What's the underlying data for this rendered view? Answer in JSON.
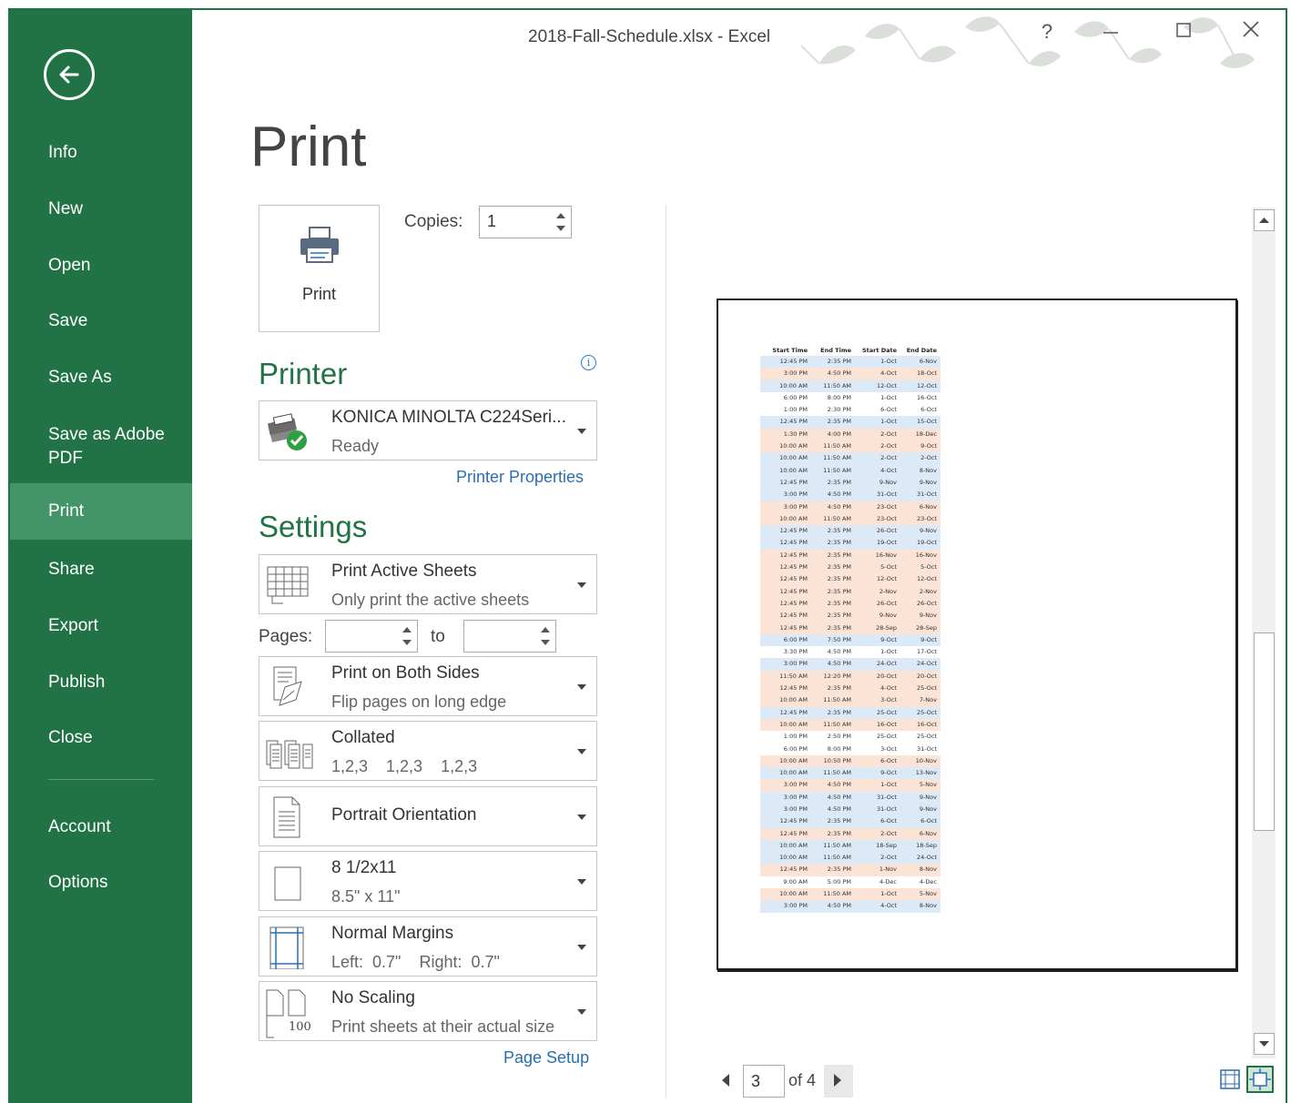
{
  "window": {
    "title": "2018-Fall-Schedule.xlsx - Excel"
  },
  "sidebar": {
    "items": [
      {
        "label": "Info"
      },
      {
        "label": "New"
      },
      {
        "label": "Open"
      },
      {
        "label": "Save"
      },
      {
        "label": "Save As"
      },
      {
        "label": "Save as Adobe\nPDF"
      },
      {
        "label": "Print"
      },
      {
        "label": "Share"
      },
      {
        "label": "Export"
      },
      {
        "label": "Publish"
      },
      {
        "label": "Close"
      },
      {
        "label": "Account"
      },
      {
        "label": "Options"
      }
    ]
  },
  "main": {
    "title": "Print",
    "print_button": "Print",
    "copies_label": "Copies:",
    "copies_value": "1",
    "printer_heading": "Printer",
    "printer": {
      "name": "KONICA MINOLTA C224Seri...",
      "status": "Ready"
    },
    "printer_properties": "Printer Properties",
    "settings_heading": "Settings",
    "settings": {
      "sheets": {
        "title": "Print Active Sheets",
        "sub": "Only print the active sheets"
      },
      "pages_label": "Pages:",
      "to_label": "to",
      "sides": {
        "title": "Print on Both Sides",
        "sub": "Flip pages on long edge"
      },
      "collated": {
        "title": "Collated",
        "sub": "1,2,3    1,2,3    1,2,3"
      },
      "orientation": {
        "title": "Portrait Orientation"
      },
      "paper": {
        "title": "8 1/2x11",
        "sub": "8.5\" x 11\""
      },
      "margins": {
        "title": "Normal Margins",
        "sub": "Left:  0.7\"    Right:  0.7\""
      },
      "scaling": {
        "title": "No Scaling",
        "sub": "Print sheets at their actual size",
        "icon_text": "100"
      }
    },
    "page_setup": "Page Setup"
  },
  "preview": {
    "headers": [
      "Start Time",
      "End Time",
      "Start Date",
      "End Date"
    ],
    "rows": [
      [
        "12:45 PM",
        "2:35 PM",
        "1-Oct",
        "6-Nov",
        "b"
      ],
      [
        "3:00 PM",
        "4:50 PM",
        "4-Oct",
        "18-Oct",
        "o"
      ],
      [
        "10:00 AM",
        "11:50 AM",
        "12-Oct",
        "12-Oct",
        "b"
      ],
      [
        "6:00 PM",
        "8:00 PM",
        "1-Oct",
        "16-Oct",
        "w"
      ],
      [
        "1:00 PM",
        "2:30 PM",
        "6-Oct",
        "6-Oct",
        "w"
      ],
      [
        "12:45 PM",
        "2:35 PM",
        "1-Oct",
        "15-Oct",
        "b"
      ],
      [
        "1:30 PM",
        "4:00 PM",
        "2-Oct",
        "18-Dec",
        "o"
      ],
      [
        "10:00 AM",
        "11:50 AM",
        "2-Oct",
        "9-Oct",
        "o"
      ],
      [
        "10:00 AM",
        "11:50 AM",
        "2-Oct",
        "2-Oct",
        "b"
      ],
      [
        "10:00 AM",
        "11:50 AM",
        "4-Oct",
        "8-Nov",
        "b"
      ],
      [
        "12:45 PM",
        "2:35 PM",
        "9-Nov",
        "9-Nov",
        "b"
      ],
      [
        "3:00 PM",
        "4:50 PM",
        "31-Oct",
        "31-Oct",
        "b"
      ],
      [
        "3:00 PM",
        "4:50 PM",
        "23-Oct",
        "6-Nov",
        "o"
      ],
      [
        "10:00 AM",
        "11:50 AM",
        "23-Oct",
        "23-Oct",
        "o"
      ],
      [
        "12:45 PM",
        "2:35 PM",
        "26-Oct",
        "9-Nov",
        "b"
      ],
      [
        "12:45 PM",
        "2:35 PM",
        "19-Oct",
        "19-Oct",
        "b"
      ],
      [
        "12:45 PM",
        "2:35 PM",
        "16-Nov",
        "16-Nov",
        "o"
      ],
      [
        "12:45 PM",
        "2:35 PM",
        "5-Oct",
        "5-Oct",
        "o"
      ],
      [
        "12:45 PM",
        "2:35 PM",
        "12-Oct",
        "12-Oct",
        "o"
      ],
      [
        "12:45 PM",
        "2:35 PM",
        "2-Nov",
        "2-Nov",
        "o"
      ],
      [
        "12:45 PM",
        "2:35 PM",
        "26-Oct",
        "26-Oct",
        "o"
      ],
      [
        "12:45 PM",
        "2:35 PM",
        "9-Nov",
        "9-Nov",
        "o"
      ],
      [
        "12:45 PM",
        "2:35 PM",
        "28-Sep",
        "28-Sep",
        "o"
      ],
      [
        "6:00 PM",
        "7:50 PM",
        "9-Oct",
        "9-Oct",
        "b"
      ],
      [
        "3:30 PM",
        "4:50 PM",
        "1-Oct",
        "17-Oct",
        "w"
      ],
      [
        "3:00 PM",
        "4:50 PM",
        "24-Oct",
        "24-Oct",
        "b"
      ],
      [
        "11:50 AM",
        "12:20 PM",
        "20-Oct",
        "20-Oct",
        "o"
      ],
      [
        "12:45 PM",
        "2:35 PM",
        "4-Oct",
        "25-Oct",
        "o"
      ],
      [
        "10:00 AM",
        "11:50 AM",
        "3-Oct",
        "7-Nov",
        "o"
      ],
      [
        "12:45 PM",
        "2:35 PM",
        "25-Oct",
        "25-Oct",
        "b"
      ],
      [
        "10:00 AM",
        "11:50 AM",
        "16-Oct",
        "16-Oct",
        "o"
      ],
      [
        "1:00 PM",
        "2:50 PM",
        "25-Oct",
        "25-Oct",
        "w"
      ],
      [
        "6:00 PM",
        "8:00 PM",
        "3-Oct",
        "31-Oct",
        "w"
      ],
      [
        "10:00 AM",
        "10:50 PM",
        "6-Oct",
        "10-Nov",
        "o"
      ],
      [
        "10:00 AM",
        "11:50 AM",
        "9-Oct",
        "13-Nov",
        "b"
      ],
      [
        "3:00 PM",
        "4:50 PM",
        "1-Oct",
        "5-Nov",
        "o"
      ],
      [
        "3:00 PM",
        "4:50 PM",
        "31-Oct",
        "9-Nov",
        "b"
      ],
      [
        "3:00 PM",
        "4:50 PM",
        "31-Oct",
        "9-Nov",
        "b"
      ],
      [
        "12:45 PM",
        "2:35 PM",
        "6-Oct",
        "6-Oct",
        "b"
      ],
      [
        "12:45 PM",
        "2:35 PM",
        "2-Oct",
        "6-Nov",
        "o"
      ],
      [
        "10:00 AM",
        "11:50 AM",
        "18-Sep",
        "18-Sep",
        "b"
      ],
      [
        "10:00 AM",
        "11:50 AM",
        "2-Oct",
        "24-Oct",
        "b"
      ],
      [
        "12:45 PM",
        "2:35 PM",
        "1-Nov",
        "8-Nov",
        "o"
      ],
      [
        "9:00 AM",
        "5:00 PM",
        "4-Dec",
        "4-Dec",
        "w"
      ],
      [
        "10:00 AM",
        "11:50 AM",
        "1-Oct",
        "5-Nov",
        "o"
      ],
      [
        "3:00 PM",
        "4:50 PM",
        "4-Oct",
        "8-Nov",
        "b"
      ]
    ],
    "current_page": "3",
    "of_pages": "of 4"
  },
  "colors": {
    "accent": "#217346",
    "row_blue": "#dce9f6",
    "row_orange": "#fbe3d5",
    "link": "#2a6fb0"
  }
}
